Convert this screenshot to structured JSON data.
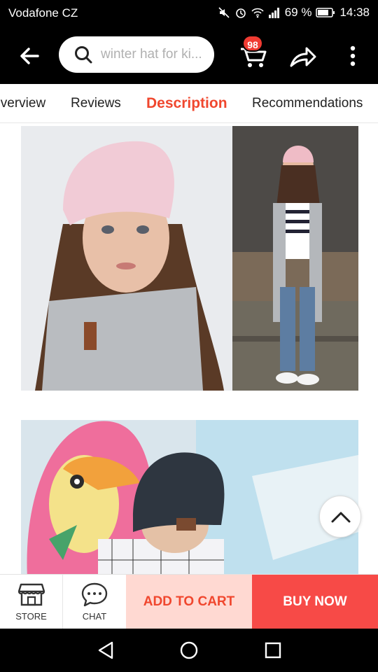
{
  "status_bar": {
    "carrier": "Vodafone CZ",
    "battery": "69 %",
    "time": "14:38"
  },
  "header": {
    "search_text": "winter hat for ki...",
    "cart_count": "98"
  },
  "tabs": [
    {
      "label": "Overview"
    },
    {
      "label": "Reviews"
    },
    {
      "label": "Description",
      "active": true
    },
    {
      "label": "Recommendations"
    }
  ],
  "bottom_bar": {
    "store_label": "STORE",
    "chat_label": "CHAT",
    "add_to_cart_label": "ADD TO CART",
    "buy_now_label": "BUY NOW"
  },
  "colors": {
    "accent": "#f0472e",
    "buy_now": "#f74a47",
    "add_to_cart_bg": "#ffd9d2"
  }
}
